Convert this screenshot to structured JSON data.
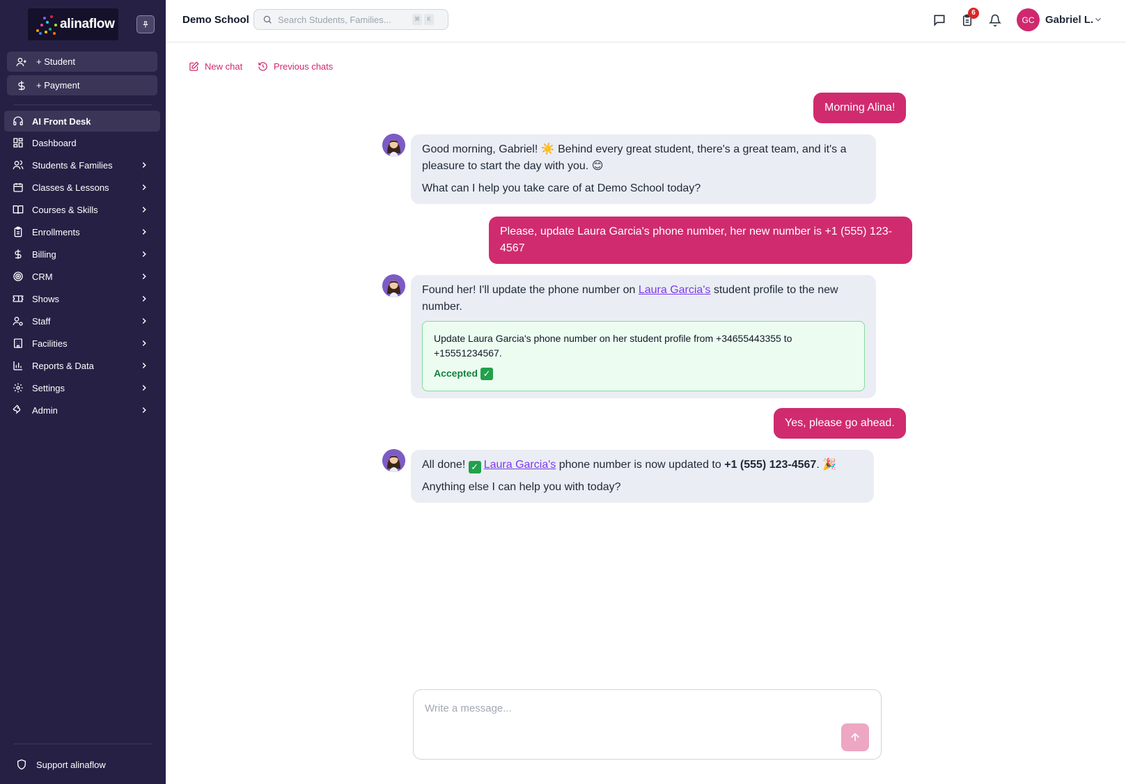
{
  "sidebar": {
    "logo_text": "alinaflow",
    "quick_actions": [
      {
        "label": "+ Student",
        "icon": "add-user-icon"
      },
      {
        "label": "+ Payment",
        "icon": "dollar-icon"
      }
    ],
    "items": [
      {
        "label": "AI Front Desk",
        "icon": "headset-icon",
        "active": true
      },
      {
        "label": "Dashboard",
        "icon": "dashboard-icon"
      },
      {
        "label": "Students & Families",
        "icon": "users-icon"
      },
      {
        "label": "Classes & Lessons",
        "icon": "calendar-icon"
      },
      {
        "label": "Courses & Skills",
        "icon": "book-icon"
      },
      {
        "label": "Enrollments",
        "icon": "clipboard-icon"
      },
      {
        "label": "Billing",
        "icon": "dollar-icon"
      },
      {
        "label": "CRM",
        "icon": "target-icon"
      },
      {
        "label": "Shows",
        "icon": "ticket-icon"
      },
      {
        "label": "Staff",
        "icon": "user-gear-icon"
      },
      {
        "label": "Facilities",
        "icon": "building-icon"
      },
      {
        "label": "Reports & Data",
        "icon": "bar-chart-icon"
      },
      {
        "label": "Settings",
        "icon": "gear-icon"
      },
      {
        "label": "Admin",
        "icon": "wrench-icon"
      }
    ],
    "support_label": "Support alinaflow"
  },
  "header": {
    "school_name": "Demo School",
    "search_placeholder": "Search Students, Families...",
    "shortcut_keys": [
      "⌘",
      "K"
    ],
    "task_badge": "6",
    "user_initials": "GC",
    "user_name": "Gabriel L."
  },
  "chat_controls": {
    "new_chat": "New chat",
    "previous_chats": "Previous chats"
  },
  "messages": {
    "m1_user": "Morning Alina!",
    "m2_ai_line1": "Good morning, Gabriel! ☀️ Behind every great student, there's a great team, and it's a pleasure to start the day with you. 😊",
    "m2_ai_line2": "What can I help you take care of at Demo School today?",
    "m3_user": "Please, update Laura Garcia's phone number, her new number is +1 (555) 123-4567",
    "m4_ai_pre": "Found her! I'll update the phone number on ",
    "m4_ai_link": "Laura Garcia's",
    "m4_ai_post": " student profile to the new number.",
    "m4_action": "Update Laura Garcia's phone number on her student profile from +34655443355 to +15551234567.",
    "m4_status": "Accepted",
    "m5_user": "Yes, please go ahead.",
    "m6_ai_pre": "All done! ",
    "m6_ai_link": "Laura Garcia's",
    "m6_ai_mid": " phone number is now updated to ",
    "m6_ai_bold": "+1 (555) 123-4567",
    "m6_ai_post": ". 🎉",
    "m6_ai_line2": "Anything else I can help you with today?"
  },
  "composer": {
    "placeholder": "Write a message..."
  },
  "colors": {
    "sidebar_bg": "#272045",
    "accent": "#d02b6f",
    "ai_bubble": "#eaedf3",
    "link": "#7c3aed",
    "success": "#15803d"
  }
}
